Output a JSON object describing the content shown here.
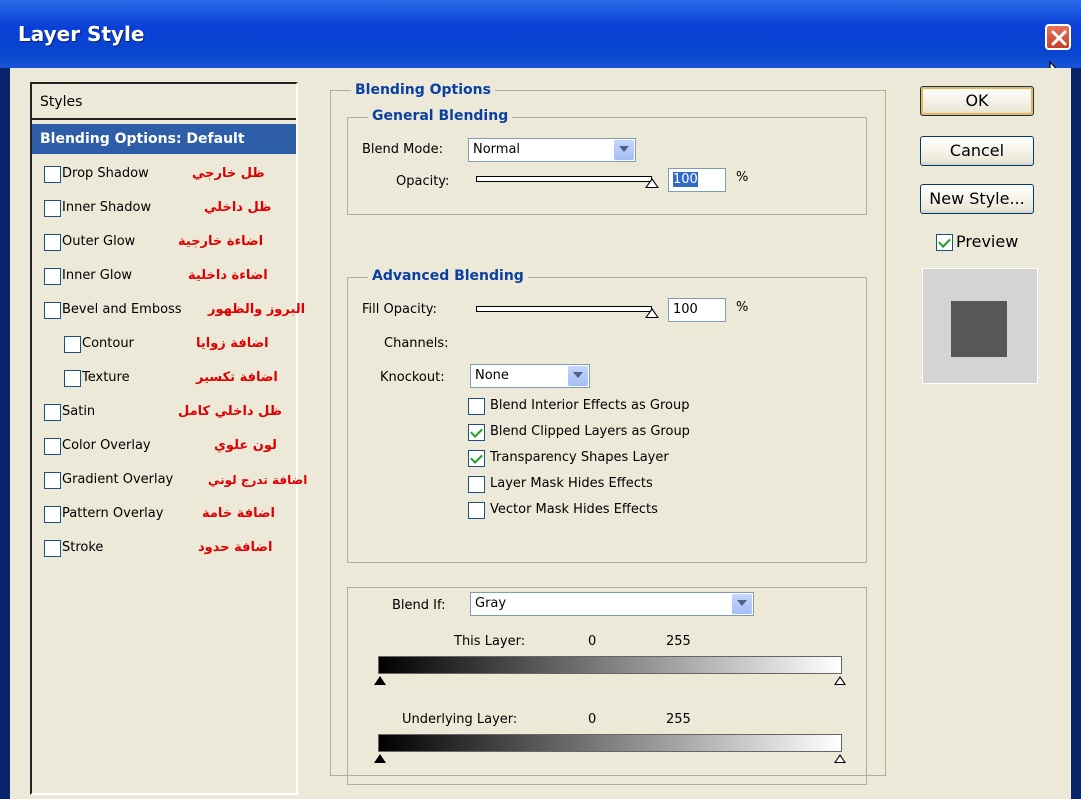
{
  "window": {
    "title": "Layer Style"
  },
  "styles": {
    "header": "Styles",
    "blending_options": "Blending Options: Default",
    "items": [
      {
        "label": "Drop Shadow",
        "arabic": "ظل خارجي",
        "checked": false
      },
      {
        "label": "Inner Shadow",
        "arabic": "ظل داخلي",
        "checked": false
      },
      {
        "label": "Outer Glow",
        "arabic": "اضاءة خارجية",
        "checked": false
      },
      {
        "label": "Inner Glow",
        "arabic": "اضاءة داخلية",
        "checked": false
      },
      {
        "label": "Bevel and Emboss",
        "arabic": "البروز والظهور",
        "checked": false
      },
      {
        "label": "Contour",
        "arabic": "اضافة زوايا",
        "checked": false
      },
      {
        "label": "Texture",
        "arabic": "اضافة تكسير",
        "checked": false
      },
      {
        "label": "Satin",
        "arabic": "ظل داخلي كامل",
        "checked": false
      },
      {
        "label": "Color Overlay",
        "arabic": "لون علوي",
        "checked": false
      },
      {
        "label": "Gradient Overlay",
        "arabic": "اضافة تدرج لوني",
        "checked": false
      },
      {
        "label": "Pattern Overlay",
        "arabic": "اضافة خامة",
        "checked": false
      },
      {
        "label": "Stroke",
        "arabic": "اضافة حدود",
        "checked": false
      }
    ]
  },
  "blending": {
    "title": "Blending Options",
    "general": {
      "title": "General Blending",
      "blend_mode_label": "Blend Mode:",
      "blend_mode_value": "Normal",
      "opacity_label": "Opacity:",
      "opacity_value": "100",
      "opacity_percent": 1.0,
      "unit": "%"
    },
    "advanced": {
      "title": "Advanced Blending",
      "fill_opacity_label": "Fill Opacity:",
      "fill_opacity_value": "100",
      "fill_opacity_percent": 1.0,
      "unit": "%",
      "channels_label": "Channels:",
      "knockout_label": "Knockout:",
      "knockout_value": "None",
      "checks": [
        {
          "label": "Blend Interior Effects as Group",
          "checked": false
        },
        {
          "label": "Blend Clipped Layers as Group",
          "checked": true
        },
        {
          "label": "Transparency Shapes Layer",
          "checked": true
        },
        {
          "label": "Layer Mask Hides Effects",
          "checked": false
        },
        {
          "label": "Vector Mask Hides Effects",
          "checked": false
        }
      ]
    },
    "blend_if": {
      "label": "Blend If:",
      "value": "Gray",
      "this_layer_label": "This Layer:",
      "this_layer_min": "0",
      "this_layer_max": "255",
      "underlying_label": "Underlying Layer:",
      "underlying_min": "0",
      "underlying_max": "255"
    }
  },
  "buttons": {
    "ok": "OK",
    "cancel": "Cancel",
    "new_style": "New Style...",
    "preview_label": "Preview",
    "preview_checked": true
  }
}
